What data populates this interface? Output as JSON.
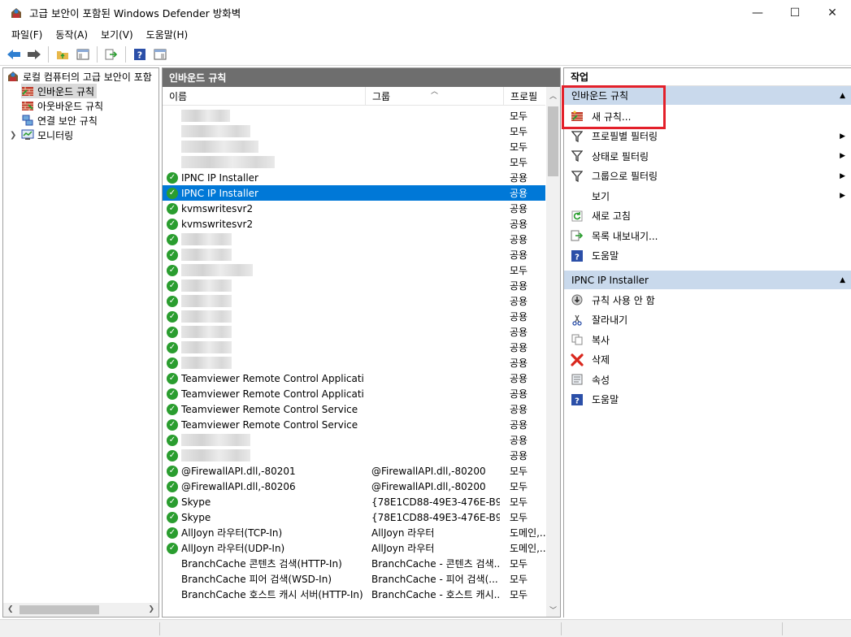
{
  "window": {
    "title": "고급 보안이 포함된 Windows Defender 방화벽",
    "minimize": "—",
    "maximize": "☐",
    "close": "✕"
  },
  "menu": [
    "파일(F)",
    "동작(A)",
    "보기(V)",
    "도움말(H)"
  ],
  "tree": {
    "root": "로컬 컴퓨터의 고급 보안이 포함",
    "items": [
      "인바운드 규칙",
      "아웃바운드 규칙",
      "연결 보안 규칙",
      "모니터링"
    ]
  },
  "middle": {
    "header": "인바운드 규칙",
    "columns": {
      "name": "이름",
      "group": "그룹",
      "profile": "프로필"
    },
    "rows": [
      {
        "name": "",
        "group": "",
        "profile": "모두",
        "check": false,
        "blur": 60
      },
      {
        "name": "",
        "group": "",
        "profile": "모두",
        "check": false,
        "blur": 85
      },
      {
        "name": "",
        "group": "",
        "profile": "모두",
        "check": false,
        "blur": 95
      },
      {
        "name": "",
        "group": "",
        "profile": "모두",
        "check": false,
        "blur": 115
      },
      {
        "name": "IPNC IP Installer",
        "group": "",
        "profile": "공용",
        "check": true
      },
      {
        "name": "IPNC IP Installer",
        "group": "",
        "profile": "공용",
        "check": true,
        "selected": true
      },
      {
        "name": "kvmswritesvr2",
        "group": "",
        "profile": "공용",
        "check": true
      },
      {
        "name": "kvmswritesvr2",
        "group": "",
        "profile": "공용",
        "check": true
      },
      {
        "name": "",
        "group": "",
        "profile": "공용",
        "check": true,
        "blur": 62
      },
      {
        "name": "",
        "group": "",
        "profile": "공용",
        "check": true,
        "blur": 62
      },
      {
        "name": "",
        "group": "",
        "profile": "모두",
        "check": true,
        "blur": 88
      },
      {
        "name": "",
        "group": "",
        "profile": "공용",
        "check": true,
        "blur": 62
      },
      {
        "name": "",
        "group": "",
        "profile": "공용",
        "check": true,
        "blur": 62
      },
      {
        "name": "",
        "group": "",
        "profile": "공용",
        "check": true,
        "blur": 62
      },
      {
        "name": "",
        "group": "",
        "profile": "공용",
        "check": true,
        "blur": 62
      },
      {
        "name": "",
        "group": "",
        "profile": "공용",
        "check": true,
        "blur": 62
      },
      {
        "name": "",
        "group": "",
        "profile": "공용",
        "check": true,
        "blur": 62
      },
      {
        "name": "Teamviewer Remote Control Application",
        "group": "",
        "profile": "공용",
        "check": true
      },
      {
        "name": "Teamviewer Remote Control Application",
        "group": "",
        "profile": "공용",
        "check": true
      },
      {
        "name": "Teamviewer Remote Control Service",
        "group": "",
        "profile": "공용",
        "check": true
      },
      {
        "name": "Teamviewer Remote Control Service",
        "group": "",
        "profile": "공용",
        "check": true
      },
      {
        "name": "",
        "group": "",
        "profile": "공용",
        "check": true,
        "blur": 85
      },
      {
        "name": "",
        "group": "",
        "profile": "공용",
        "check": true,
        "blur": 85
      },
      {
        "name": "@FirewallAPI.dll,-80201",
        "group": "@FirewallAPI.dll,-80200",
        "profile": "모두",
        "check": true
      },
      {
        "name": "@FirewallAPI.dll,-80206",
        "group": "@FirewallAPI.dll,-80200",
        "profile": "모두",
        "check": true
      },
      {
        "name": "Skype",
        "group": "{78E1CD88-49E3-476E-B9...",
        "profile": "모두",
        "check": true
      },
      {
        "name": "Skype",
        "group": "{78E1CD88-49E3-476E-B9...",
        "profile": "모두",
        "check": true
      },
      {
        "name": "AllJoyn 라우터(TCP-In)",
        "group": "AllJoyn 라우터",
        "profile": "도메인,...",
        "check": true
      },
      {
        "name": "AllJoyn 라우터(UDP-In)",
        "group": "AllJoyn 라우터",
        "profile": "도메인,...",
        "check": true
      },
      {
        "name": "BranchCache 콘텐츠 검색(HTTP-In)",
        "group": "BranchCache - 콘텐츠 검색...",
        "profile": "모두",
        "check": false
      },
      {
        "name": "BranchCache 피어 검색(WSD-In)",
        "group": "BranchCache - 피어 검색(...",
        "profile": "모두",
        "check": false
      },
      {
        "name": "BranchCache 호스트 캐시 서버(HTTP-In)",
        "group": "BranchCache - 호스트 캐시...",
        "profile": "모두",
        "check": false
      }
    ]
  },
  "actions": {
    "title": "작업",
    "section1": {
      "title": "인바운드 규칙",
      "items": [
        {
          "label": "새 규칙...",
          "icon": "new-rule-icon"
        },
        {
          "label": "프로필별 필터링",
          "icon": "filter-icon",
          "submenu": true
        },
        {
          "label": "상태로 필터링",
          "icon": "filter-icon",
          "submenu": true
        },
        {
          "label": "그룹으로 필터링",
          "icon": "filter-icon",
          "submenu": true
        },
        {
          "label": "보기",
          "icon": "",
          "submenu": true
        },
        {
          "label": "새로 고침",
          "icon": "refresh-icon"
        },
        {
          "label": "목록 내보내기...",
          "icon": "export-icon"
        },
        {
          "label": "도움말",
          "icon": "help-icon"
        }
      ]
    },
    "section2": {
      "title": "IPNC IP Installer",
      "items": [
        {
          "label": "규칙 사용 안 함",
          "icon": "disable-icon"
        },
        {
          "label": "잘라내기",
          "icon": "cut-icon"
        },
        {
          "label": "복사",
          "icon": "copy-icon"
        },
        {
          "label": "삭제",
          "icon": "delete-icon"
        },
        {
          "label": "속성",
          "icon": "properties-icon"
        },
        {
          "label": "도움말",
          "icon": "help-icon"
        }
      ]
    }
  },
  "colors": {
    "selection": "#0078d7",
    "section_header": "#c9d9ec",
    "pane_header": "#6e6e6e",
    "check_green": "#2a9d2f",
    "highlight_red": "#e3202a"
  }
}
